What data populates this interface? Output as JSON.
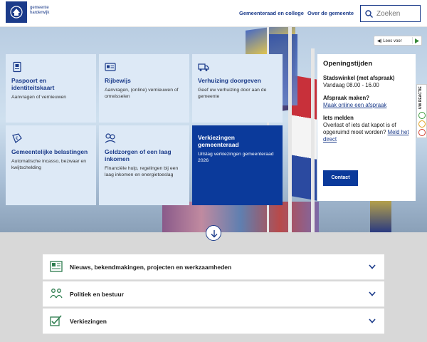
{
  "header": {
    "logo_line1": "gemeente",
    "logo_line2": "harderwijk",
    "nav": [
      "Gemeenteraad en college",
      "Over de gemeente"
    ],
    "search_placeholder": "Zoeken"
  },
  "readspeaker": {
    "label": "Lees voor"
  },
  "tiles": [
    {
      "title": "Paspoort en identiteitskaart",
      "desc": "Aanvragen of vernieuwen",
      "icon": "passport-icon"
    },
    {
      "title": "Rijbewijs",
      "desc": "Aanvragen, (online) vernieuwen of omwisselen",
      "icon": "drivers-license-icon"
    },
    {
      "title": "Verhuizing doorgeven",
      "desc": "Geef uw verhuizing door aan de gemeente",
      "icon": "moving-truck-icon"
    },
    {
      "title": "Gemeentelijke belastingen",
      "desc": "Automatische incasso, bezwaar en kwijtschelding",
      "icon": "tax-icon"
    },
    {
      "title": "Geldzorgen of een laag inkomen",
      "desc": "Financiële hulp, regelingen bij een laag inkomen en energietoeslag",
      "icon": "money-help-icon"
    },
    {
      "title": "Verkiezingen gemeenteraad",
      "desc": "Uitslag verkiezingen gemeenteraad 2026",
      "icon": ""
    }
  ],
  "hours": {
    "title": "Openingstijden",
    "place": "Stadswinkel (met afspraak)",
    "time": "Vandaag 08.00 - 16.00",
    "appointment_title": "Afspraak maken?",
    "appointment_link": "Maak online een afspraak",
    "report_title": "Iets melden",
    "report_text": "Overlast of iets dat kapot is of opgeruimd moet worden?",
    "report_link": "Meld het direct",
    "contact_button": "Contact"
  },
  "feedback": {
    "label": "UW REACTIE"
  },
  "accordion": [
    {
      "label": "Nieuws, bekendmakingen, projecten en werkzaamheden",
      "icon": "newspaper-icon"
    },
    {
      "label": "Politiek en bestuur",
      "icon": "people-icon"
    },
    {
      "label": "Verkiezingen",
      "icon": "ballot-icon"
    }
  ],
  "colors": {
    "primary": "#1b3b8a",
    "tile_bg": "#dde9f6",
    "highlight_tile": "#0b3a9b",
    "page_bg": "#d8d8d8"
  }
}
